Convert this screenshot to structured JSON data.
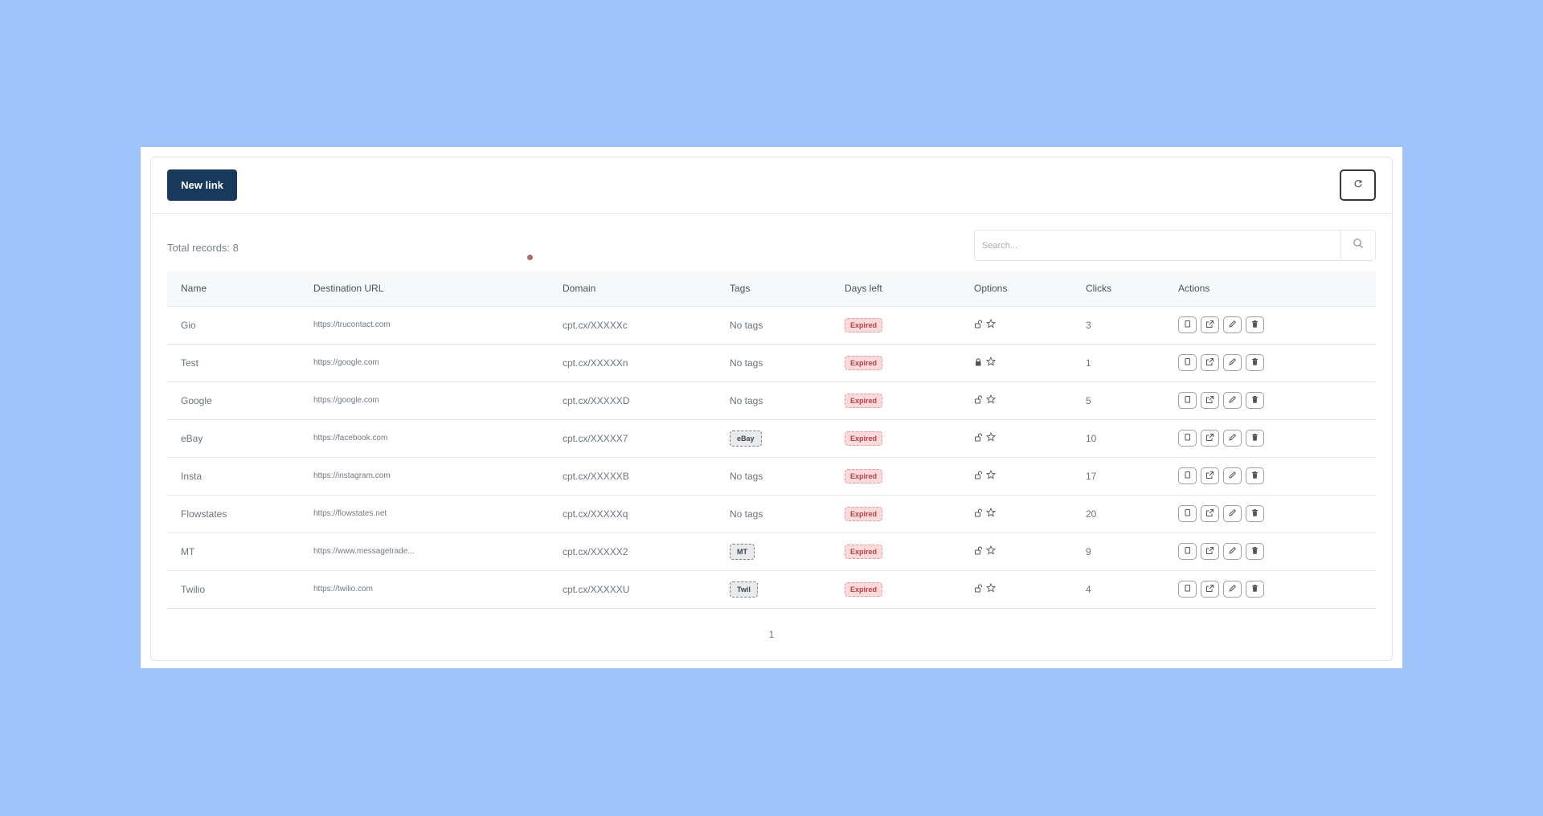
{
  "header": {
    "new_link_label": "New link"
  },
  "toolbar": {
    "total_records": "Total records: 8",
    "search_placeholder": "Search..."
  },
  "table": {
    "columns": [
      "Name",
      "Destination URL",
      "Domain",
      "Tags",
      "Days left",
      "Options",
      "Clicks",
      "Actions"
    ],
    "rows": [
      {
        "name": "Gio",
        "url": "https://trucontact.com",
        "domain": "cpt.cx/XXXXXc",
        "tags": "No tags",
        "tag_badge": false,
        "days_left": "Expired",
        "locked": false,
        "clicks": "3"
      },
      {
        "name": "Test",
        "url": "https://google.com",
        "domain": "cpt.cx/XXXXXn",
        "tags": "No tags",
        "tag_badge": false,
        "days_left": "Expired",
        "locked": true,
        "clicks": "1"
      },
      {
        "name": "Google",
        "url": "https://google.com",
        "domain": "cpt.cx/XXXXXD",
        "tags": "No tags",
        "tag_badge": false,
        "days_left": "Expired",
        "locked": false,
        "clicks": "5"
      },
      {
        "name": "eBay",
        "url": "https://facebook.com",
        "domain": "cpt.cx/XXXXX7",
        "tags": "eBay",
        "tag_badge": true,
        "days_left": "Expired",
        "locked": false,
        "clicks": "10"
      },
      {
        "name": "Insta",
        "url": "https://instagram.com",
        "domain": "cpt.cx/XXXXXB",
        "tags": "No tags",
        "tag_badge": false,
        "days_left": "Expired",
        "locked": false,
        "clicks": "17"
      },
      {
        "name": "Flowstates",
        "url": "https://flowstates.net",
        "domain": "cpt.cx/XXXXXq",
        "tags": "No tags",
        "tag_badge": false,
        "days_left": "Expired",
        "locked": false,
        "clicks": "20"
      },
      {
        "name": "MT",
        "url": "https://www.messagetrade...",
        "domain": "cpt.cx/XXXXX2",
        "tags": "MT",
        "tag_badge": true,
        "days_left": "Expired",
        "locked": false,
        "clicks": "9"
      },
      {
        "name": "Twilio",
        "url": "https://twilio.com",
        "domain": "cpt.cx/XXXXXU",
        "tags": "Twil",
        "tag_badge": true,
        "days_left": "Expired",
        "locked": false,
        "clicks": "4"
      }
    ]
  },
  "pagination": {
    "current_page": "1"
  },
  "colors": {
    "background": "#9ec4fb",
    "primary_button": "#173a5c",
    "expired_bg": "#fcdada",
    "expired_text": "#b5404a"
  },
  "icons": {
    "options": [
      "lock-icon",
      "star-icon"
    ],
    "actions": [
      "copy-icon",
      "external-link-icon",
      "edit-icon",
      "delete-icon"
    ]
  }
}
